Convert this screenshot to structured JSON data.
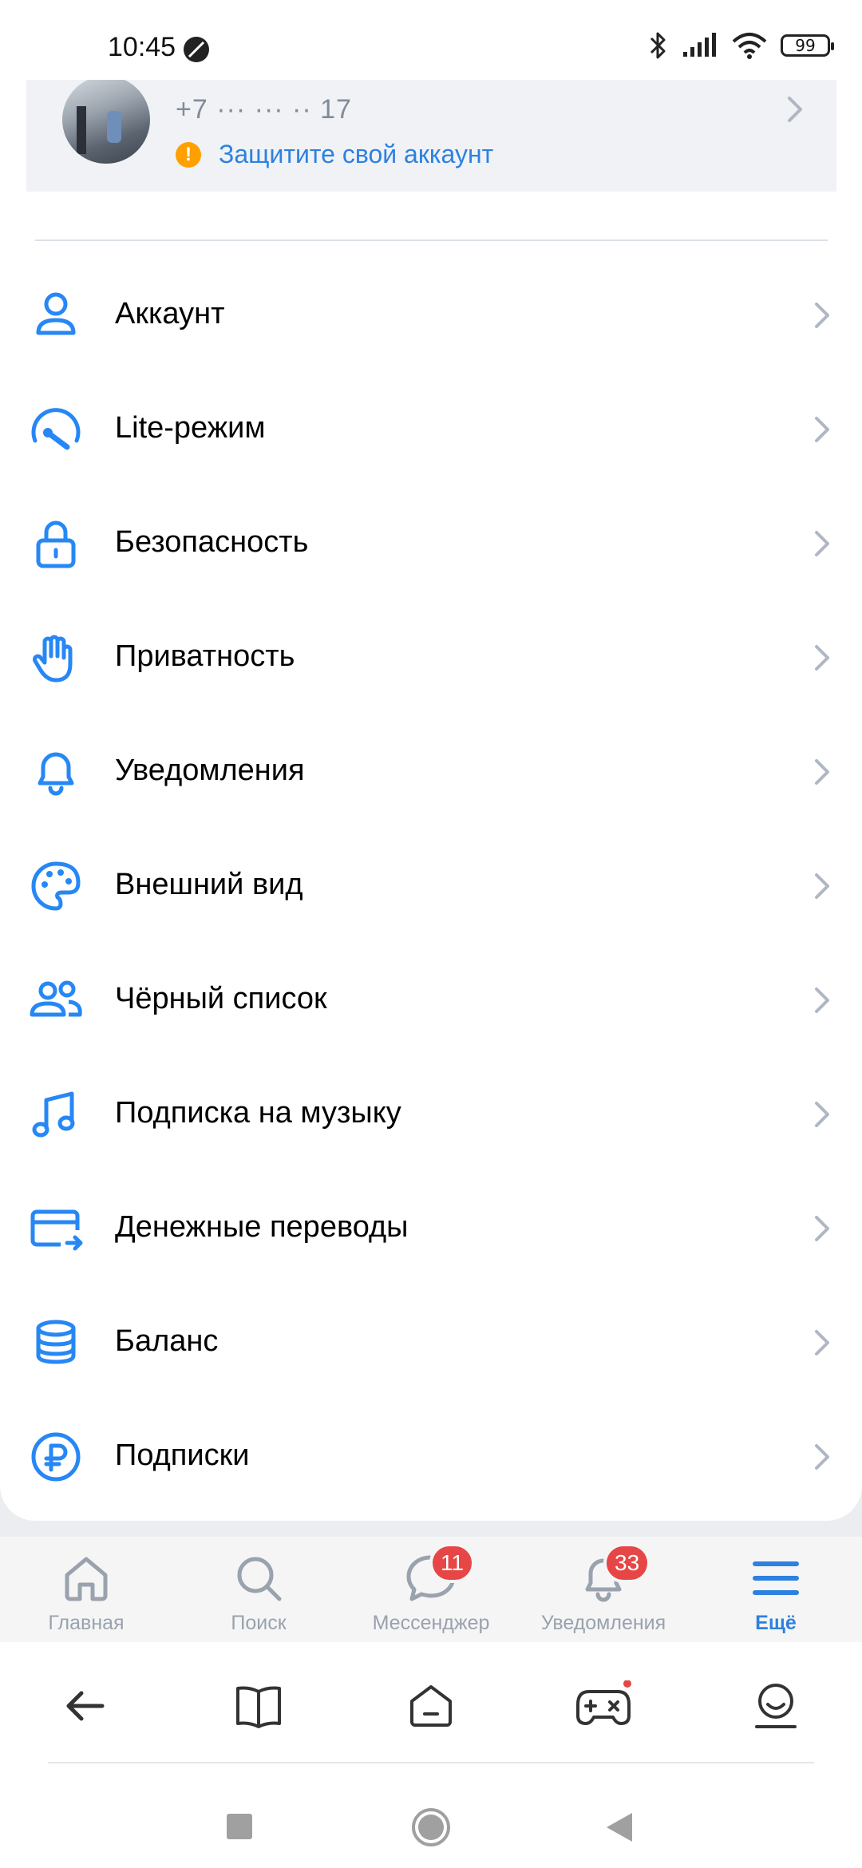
{
  "status_bar": {
    "time": "10:45",
    "battery": "99",
    "icons": [
      "moon-icon",
      "bluetooth-icon",
      "signal-icon",
      "wifi-icon",
      "battery-icon"
    ]
  },
  "profile": {
    "phone": "+7 ··· ··· ·· 17",
    "warning": "Защитите свой аккаунт"
  },
  "menu": {
    "items": [
      {
        "label": "Аккаунт",
        "icon": "user-icon"
      },
      {
        "label": "Lite-режим",
        "icon": "speedometer-icon"
      },
      {
        "label": "Безопасность",
        "icon": "lock-icon"
      },
      {
        "label": "Приватность",
        "icon": "hand-icon"
      },
      {
        "label": "Уведомления",
        "icon": "bell-icon"
      },
      {
        "label": "Внешний вид",
        "icon": "palette-icon"
      },
      {
        "label": "Чёрный список",
        "icon": "users-icon"
      },
      {
        "label": "Подписка на музыку",
        "icon": "music-icon"
      },
      {
        "label": "Денежные переводы",
        "icon": "card-transfer-icon"
      },
      {
        "label": "Баланс",
        "icon": "coins-icon"
      },
      {
        "label": "Подписки",
        "icon": "ruble-icon"
      }
    ]
  },
  "tabbar": {
    "tabs": [
      {
        "label": "Главная",
        "icon": "home-icon"
      },
      {
        "label": "Поиск",
        "icon": "search-icon"
      },
      {
        "label": "Мессенджер",
        "icon": "chat-icon",
        "badge": "11"
      },
      {
        "label": "Уведомления",
        "icon": "bell-icon",
        "badge": "33"
      },
      {
        "label": "Ещё",
        "icon": "menu-icon",
        "active": true
      }
    ]
  },
  "colors": {
    "accent": "#2d81e0",
    "icon_blue": "#2787f5",
    "badge_red": "#e64646",
    "warning_orange": "#ffa000"
  }
}
